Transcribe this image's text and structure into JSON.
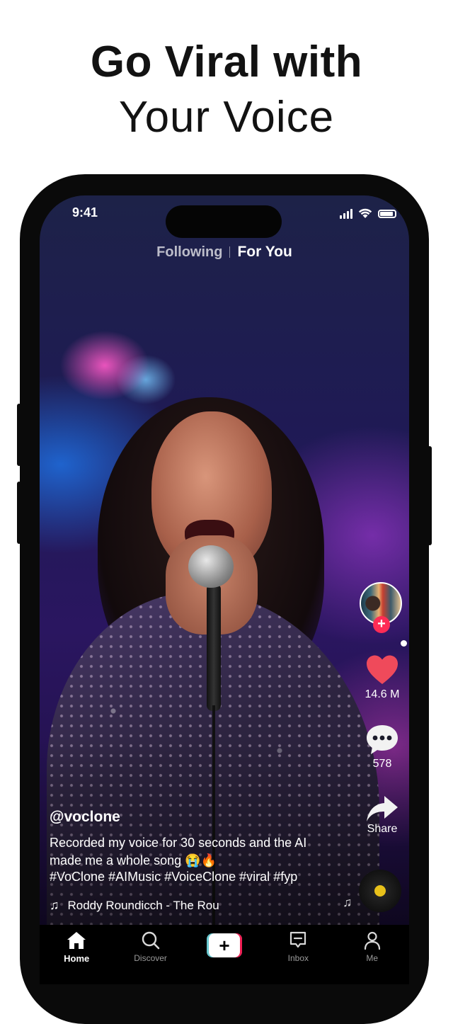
{
  "headline": {
    "line1": "Go Viral with",
    "line2": "Your Voice"
  },
  "status_bar": {
    "time": "9:41"
  },
  "feed_tabs": {
    "following": "Following",
    "for_you": "For You",
    "active": "For You"
  },
  "actions": {
    "avatar_follow": "+",
    "likes": "14.6 M",
    "comments": "578",
    "share": "Share"
  },
  "post": {
    "username": "@voclone",
    "caption": "Recorded my voice for 30 seconds and the AI made me a whole song 😭🔥",
    "hashtags": "#VoClone #AIMusic #VoiceClone #viral #fyp",
    "music": "Roddy Roundicch - The Rou"
  },
  "nav": {
    "items": [
      {
        "label": "Home",
        "icon": "home-icon",
        "active": true
      },
      {
        "label": "Discover",
        "icon": "search-icon",
        "active": false
      },
      {
        "label": "+",
        "icon": "create-icon",
        "active": false
      },
      {
        "label": "Inbox",
        "icon": "inbox-icon",
        "active": false
      },
      {
        "label": "Me",
        "icon": "profile-icon",
        "active": false
      }
    ]
  },
  "colors": {
    "accent_red": "#fe2c55",
    "like_red": "#ef4a5b",
    "tiktok_cyan": "#69c9d0",
    "tiktok_pink": "#ee1d52",
    "disc_gold": "#e8c11a"
  }
}
